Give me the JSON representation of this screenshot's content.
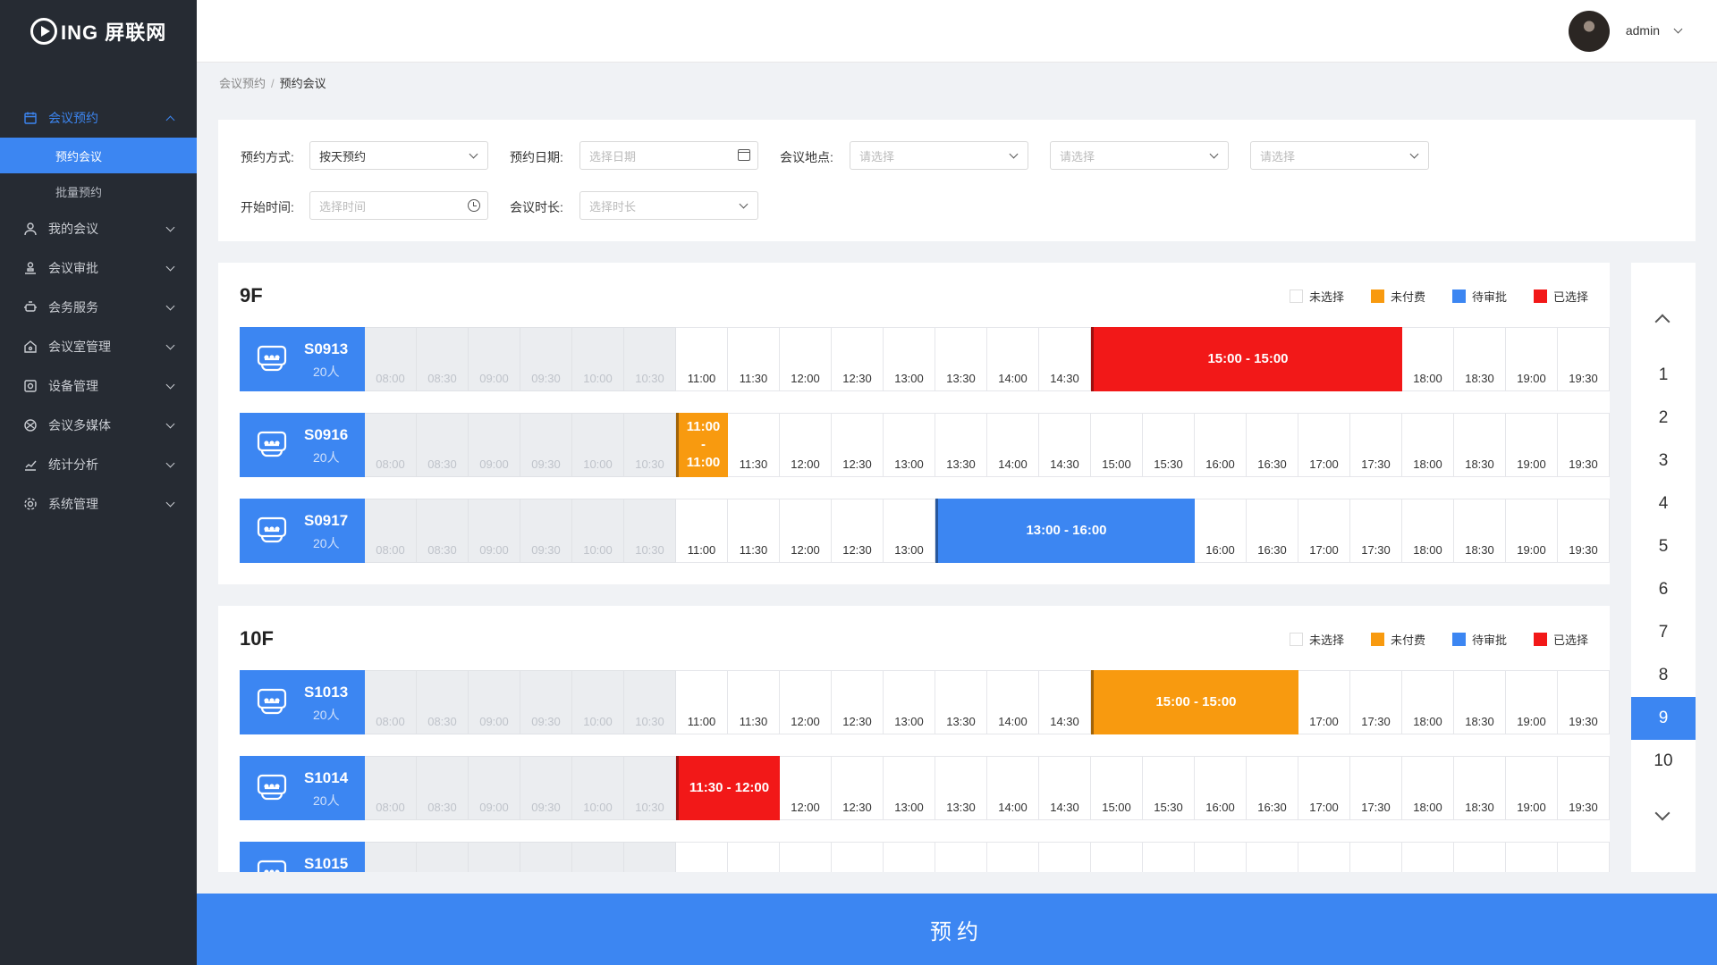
{
  "brand": {
    "logo_text": "ING 屏联网"
  },
  "sidebar": {
    "items": [
      {
        "label": "会议预约",
        "icon": "calendar-icon",
        "open": true,
        "subitems": [
          {
            "label": "预约会议",
            "active": true
          },
          {
            "label": "批量预约",
            "active": false
          }
        ]
      },
      {
        "label": "我的会议",
        "icon": "user-icon"
      },
      {
        "label": "会议审批",
        "icon": "approval-icon"
      },
      {
        "label": "会务服务",
        "icon": "service-icon"
      },
      {
        "label": "会议室管理",
        "icon": "room-manage-icon"
      },
      {
        "label": "设备管理",
        "icon": "device-icon"
      },
      {
        "label": "会议多媒体",
        "icon": "multimedia-icon"
      },
      {
        "label": "统计分析",
        "icon": "chart-icon"
      },
      {
        "label": "系统管理",
        "icon": "settings-icon"
      }
    ]
  },
  "header": {
    "username": "admin"
  },
  "breadcrumb": {
    "parent": "会议预约",
    "separator": "/",
    "current": "预约会议"
  },
  "filters": {
    "mode_label": "预约方式:",
    "mode_value": "按天预约",
    "date_label": "预约日期:",
    "date_placeholder": "选择日期",
    "location_label": "会议地点:",
    "location_placeholder_1": "请选择",
    "location_placeholder_2": "请选择",
    "location_placeholder_3": "请选择",
    "start_label": "开始时间:",
    "start_placeholder": "选择时间",
    "duration_label": "会议时长:",
    "duration_placeholder": "选择时长"
  },
  "legend": [
    {
      "label": "未选择",
      "color": "#ffffff"
    },
    {
      "label": "未付费",
      "color": "#f89a0f"
    },
    {
      "label": "待审批",
      "color": "#3c86f2"
    },
    {
      "label": "已选择",
      "color": "#f21818"
    }
  ],
  "times": [
    "08:00",
    "08:30",
    "09:00",
    "09:30",
    "10:00",
    "10:30",
    "11:00",
    "11:30",
    "12:00",
    "12:30",
    "13:00",
    "13:30",
    "14:00",
    "14:30",
    "15:00",
    "15:30",
    "16:00",
    "16:30",
    "17:00",
    "17:30",
    "18:00",
    "18:30",
    "19:00",
    "19:30"
  ],
  "disabled_slots": 6,
  "floors": [
    {
      "title": "9F",
      "rooms": [
        {
          "name": "S0913",
          "capacity": "20人",
          "bookings": [
            {
              "start": 14,
              "span": 6,
              "label": "15:00 - 15:00",
              "color": "#f21818"
            }
          ]
        },
        {
          "name": "S0916",
          "capacity": "20人",
          "bookings": [
            {
              "start": 6,
              "span": 1,
              "label": "11:00\n-\n11:00",
              "color": "#f89a0f"
            }
          ]
        },
        {
          "name": "S0917",
          "capacity": "20人",
          "bookings": [
            {
              "start": 11,
              "span": 5,
              "label": "13:00 - 16:00",
              "color": "#3c86f2"
            }
          ]
        }
      ]
    },
    {
      "title": "10F",
      "rooms": [
        {
          "name": "S1013",
          "capacity": "20人",
          "bookings": [
            {
              "start": 14,
              "span": 4,
              "label": "15:00 - 15:00",
              "color": "#f89a0f"
            }
          ]
        },
        {
          "name": "S1014",
          "capacity": "20人",
          "bookings": [
            {
              "start": 6,
              "span": 2,
              "label": "11:30 - 12:00",
              "color": "#f21818"
            }
          ]
        },
        {
          "name": "S1015",
          "capacity": "",
          "bookings": []
        }
      ]
    }
  ],
  "pager": {
    "pages": [
      "1",
      "2",
      "3",
      "4",
      "5",
      "6",
      "7",
      "8",
      "9",
      "10"
    ],
    "active": "9"
  },
  "submit_label": "预约"
}
